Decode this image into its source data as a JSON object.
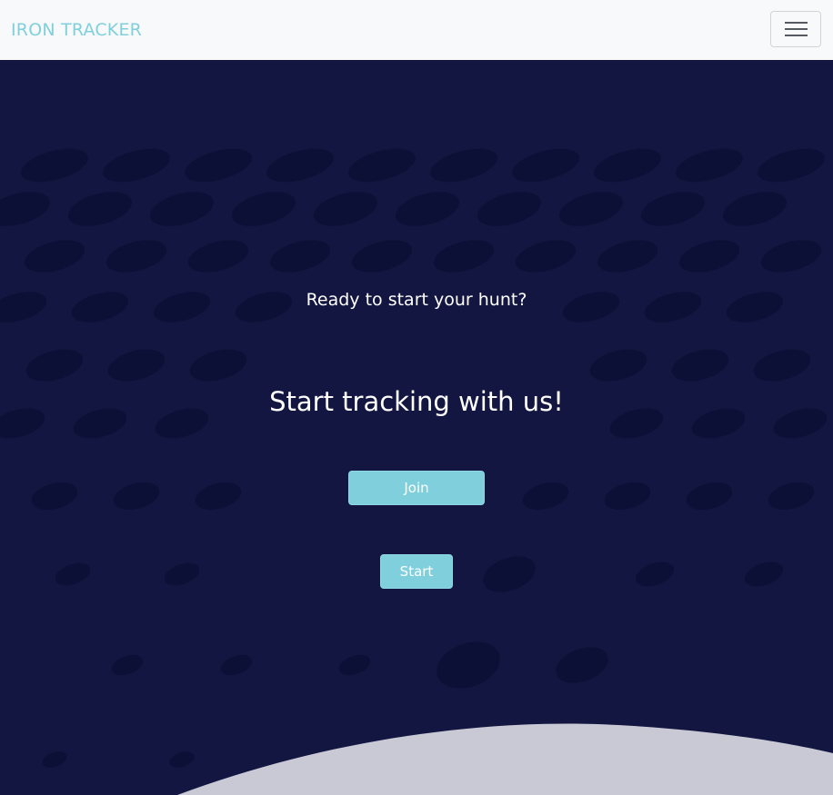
{
  "navbar": {
    "brand": "IRON TRACKER",
    "toggler_icon": "hamburger-menu-icon"
  },
  "hero": {
    "tagline": "Ready to start your hunt?",
    "headline": "Start tracking with us!",
    "join_label": "Join",
    "start_label": "Start"
  },
  "colors": {
    "navbar_bg": "#f8f9fa",
    "brand": "#7fd0dc",
    "hero_bg": "#131640",
    "button_bg": "#7fd0dc",
    "curve": "#c8c9d4"
  }
}
